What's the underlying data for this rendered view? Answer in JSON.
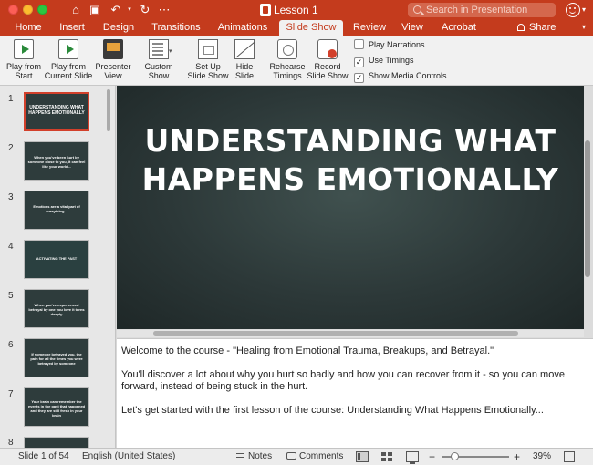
{
  "window": {
    "title": "Lesson 1",
    "search_placeholder": "Search in Presentation"
  },
  "quick_access": {
    "home_icon": "home-icon",
    "save_icon": "save-icon",
    "undo_icon": "undo-icon",
    "redo_icon": "redo-icon",
    "more_icon": "more-icon"
  },
  "tabs": [
    {
      "label": "Home"
    },
    {
      "label": "Insert"
    },
    {
      "label": "Design"
    },
    {
      "label": "Transitions"
    },
    {
      "label": "Animations"
    },
    {
      "label": "Slide Show",
      "active": true
    },
    {
      "label": "Review"
    },
    {
      "label": "View"
    },
    {
      "label": "Acrobat"
    }
  ],
  "share_label": "Share",
  "ribbon": {
    "buttons": [
      {
        "line1": "Play from",
        "line2": "Start"
      },
      {
        "line1": "Play from",
        "line2": "Current Slide"
      },
      {
        "line1": "Presenter",
        "line2": "View"
      },
      {
        "line1": "Custom",
        "line2": "Show"
      },
      {
        "line1": "Set Up",
        "line2": "Slide Show"
      },
      {
        "line1": "Hide",
        "line2": "Slide"
      },
      {
        "line1": "Rehearse",
        "line2": "Timings"
      },
      {
        "line1": "Record",
        "line2": "Slide Show"
      }
    ],
    "checkboxes": [
      {
        "label": "Play Narrations",
        "checked": false
      },
      {
        "label": "Use Timings",
        "checked": true
      },
      {
        "label": "Show Media Controls",
        "checked": true
      }
    ]
  },
  "thumbnails": [
    {
      "number": "1",
      "text": "UNDERSTANDING WHAT HAPPENS EMOTIONALLY"
    },
    {
      "number": "2",
      "text": "When you've been hurt by someone close to you, it can feel like your world..."
    },
    {
      "number": "3",
      "text": "Emotions are a vital part of everything..."
    },
    {
      "number": "4",
      "text": "ACTIVATING THE PAST"
    },
    {
      "number": "5",
      "text": "When you've experienced betrayal by one you love it turns deeply"
    },
    {
      "number": "6",
      "text": "If someone betrayed you, the pain for all the times you were betrayed by someone"
    },
    {
      "number": "7",
      "text": "Your brain can remember the events in the past that happened and they are still fresh in your brain"
    },
    {
      "number": "8",
      "text": ""
    }
  ],
  "slide": {
    "title_line1": "UNDERSTANDING WHAT",
    "title_line2": "HAPPENS EMOTIONALLY"
  },
  "notes": {
    "p1": "Welcome to the course - \"Healing from Emotional Trauma, Breakups, and Betrayal.\"",
    "p2": "You'll discover a lot about why you hurt so badly and how you can recover from it - so you can move forward, instead of being stuck in the hurt.",
    "p3": "Let's get started with the first lesson of the course: Understanding What Happens Emotionally..."
  },
  "status": {
    "slide_counter": "Slide 1 of 54",
    "language": "English (United States)",
    "notes_label": "Notes",
    "comments_label": "Comments",
    "zoom": "39%",
    "zoom_minus": "−",
    "zoom_plus": "+"
  },
  "colors": {
    "accent": "#c43b1d",
    "slide_bg": "#2c3838"
  }
}
